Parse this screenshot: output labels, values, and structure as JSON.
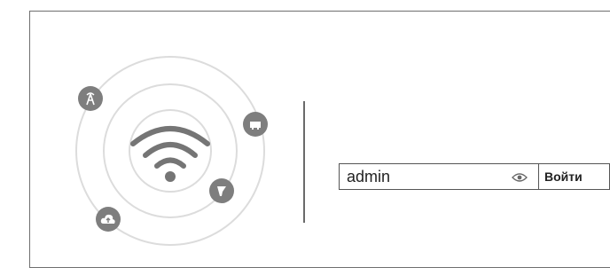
{
  "login": {
    "password_value": "admin",
    "submit_label": "Войти"
  },
  "icons": {
    "center": "wifi-icon",
    "orbit": [
      "antenna-tower-icon",
      "router-icon",
      "satellite-dish-icon",
      "cloud-upload-icon"
    ]
  },
  "colors": {
    "icon_gray": "#7e7e7e",
    "ring_gray": "#d6d6d6",
    "wifi_gray": "#757575",
    "border": "#555555"
  }
}
